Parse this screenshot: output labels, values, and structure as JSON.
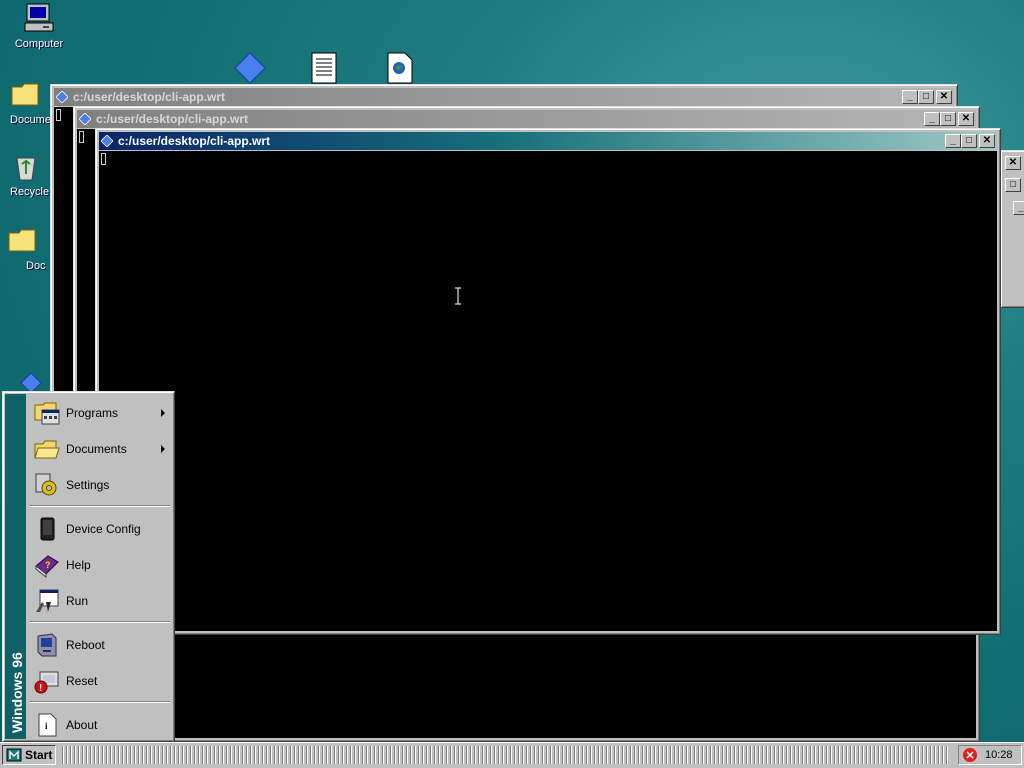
{
  "desktop": {
    "icons": [
      {
        "label": "Computer",
        "icon": "computer-icon"
      },
      {
        "label": "Docume",
        "icon": "folder-icon"
      },
      {
        "label": "Recycle",
        "icon": "recycle-bin-icon"
      },
      {
        "label": "Doc",
        "icon": "folder-icon"
      }
    ]
  },
  "windows": [
    {
      "title": "c:/user/desktop/cli-app.wrt",
      "state": "inactive"
    },
    {
      "title": "c:/user/desktop/cli-app.wrt",
      "state": "inactive"
    },
    {
      "title": "c:/user/desktop/cli-app.wrt",
      "state": "active"
    }
  ],
  "start_menu": {
    "brand": "Windows 96",
    "items": [
      {
        "label": "Programs",
        "icon": "programs-icon",
        "submenu": true
      },
      {
        "label": "Documents",
        "icon": "documents-folder-icon",
        "submenu": true
      },
      {
        "label": "Settings",
        "icon": "settings-icon",
        "submenu": false
      },
      {
        "label": "Device Config",
        "icon": "device-config-icon",
        "submenu": false
      },
      {
        "label": "Help",
        "icon": "help-book-icon",
        "submenu": false
      },
      {
        "label": "Run",
        "icon": "run-icon",
        "submenu": false
      },
      {
        "label": "Reboot",
        "icon": "reboot-icon",
        "submenu": false
      },
      {
        "label": "Reset",
        "icon": "reset-icon",
        "submenu": false
      },
      {
        "label": "About",
        "icon": "about-icon",
        "submenu": false
      }
    ]
  },
  "taskbar": {
    "start_label": "Start",
    "clock": "10:28",
    "tray_icon": "error-icon"
  },
  "colors": {
    "desktop": "#1f7d82",
    "active_title_start": "#0a246a",
    "terminal_bg": "#000000"
  }
}
